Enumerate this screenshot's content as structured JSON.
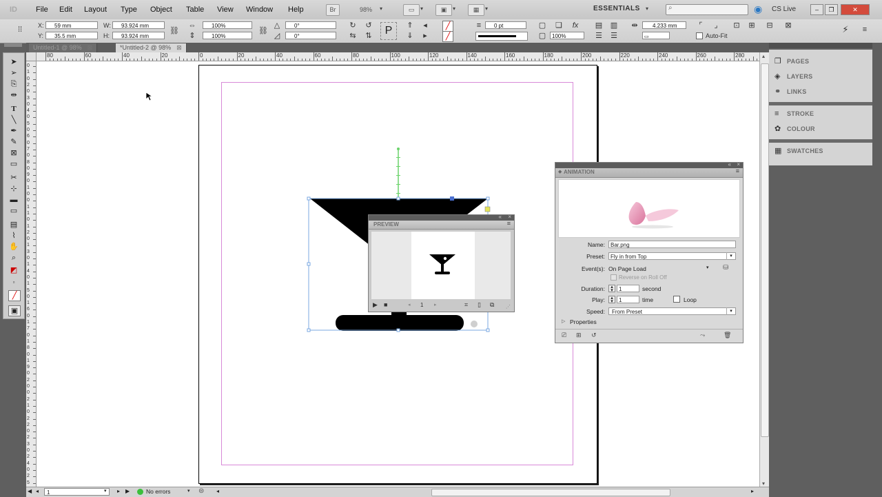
{
  "app": {
    "logo": "ID"
  },
  "menubar": {
    "items": [
      "File",
      "Edit",
      "Layout",
      "Type",
      "Object",
      "Table",
      "View",
      "Window",
      "Help"
    ],
    "bridge_label": "Br",
    "zoom": "98%",
    "workspace": "ESSENTIALS",
    "cs_live": "CS Live"
  },
  "control": {
    "x_label": "X:",
    "x_value": "59 mm",
    "y_label": "Y:",
    "y_value": "35.5 mm",
    "w_label": "W:",
    "w_value": "93.924 mm",
    "h_label": "H:",
    "h_value": "93.924 mm",
    "scale_x": "100%",
    "scale_y": "100%",
    "rotate": "0°",
    "shear": "0°",
    "stroke_weight": "0 pt",
    "opacity": "100%",
    "spacing": "4.233 mm",
    "auto_fit": "Auto-Fit"
  },
  "tabs": [
    {
      "label": "Untitled-1 @ 98%",
      "active": false
    },
    {
      "label": "*Untitled-2 @ 98%",
      "active": true
    }
  ],
  "ruler": {
    "h_labels": [
      "80",
      "60",
      "40",
      "20",
      "0",
      "20",
      "40",
      "60",
      "80",
      "100",
      "120",
      "140",
      "160",
      "180",
      "200",
      "220",
      "240",
      "260",
      "280"
    ],
    "v_labels": [
      "0",
      "1",
      "0",
      "2",
      "0",
      "3",
      "0",
      "4",
      "0",
      "5",
      "0",
      "6",
      "0",
      "7",
      "0",
      "8",
      "0",
      "9",
      "0",
      "1",
      "0",
      "0",
      "1",
      "1",
      "0",
      "1",
      "2",
      "0",
      "1",
      "3",
      "0",
      "1",
      "4",
      "0",
      "1",
      "5",
      "0",
      "1",
      "6",
      "0",
      "1",
      "7",
      "0",
      "1",
      "8",
      "0",
      "1",
      "9",
      "0",
      "2",
      "0",
      "0",
      "2",
      "1",
      "0",
      "2",
      "2",
      "0",
      "2",
      "3",
      "0",
      "2",
      "4",
      "0",
      "2",
      "5",
      "0"
    ]
  },
  "panels": {
    "pages": "PAGES",
    "layers": "LAYERS",
    "links": "LINKS",
    "stroke": "STROKE",
    "colour": "COLOUR",
    "swatches": "SWATCHES"
  },
  "animation": {
    "title": "ANIMATION",
    "name_label": "Name:",
    "name_value": "Bar.png",
    "preset_label": "Preset:",
    "preset_value": "Fly in from Top",
    "events_label": "Event(s):",
    "events_value": "On Page Load",
    "reverse_label": "Reverse on Roll Off",
    "duration_label": "Duration:",
    "duration_value": "1",
    "duration_unit": "second",
    "play_label": "Play:",
    "play_value": "1",
    "play_unit": "time",
    "loop_label": "Loop",
    "speed_label": "Speed:",
    "speed_value": "From Preset",
    "properties_label": "Properties"
  },
  "preview": {
    "title": "PREVIEW",
    "page_number": "1"
  },
  "status": {
    "page": "1",
    "preflight": "No errors"
  }
}
